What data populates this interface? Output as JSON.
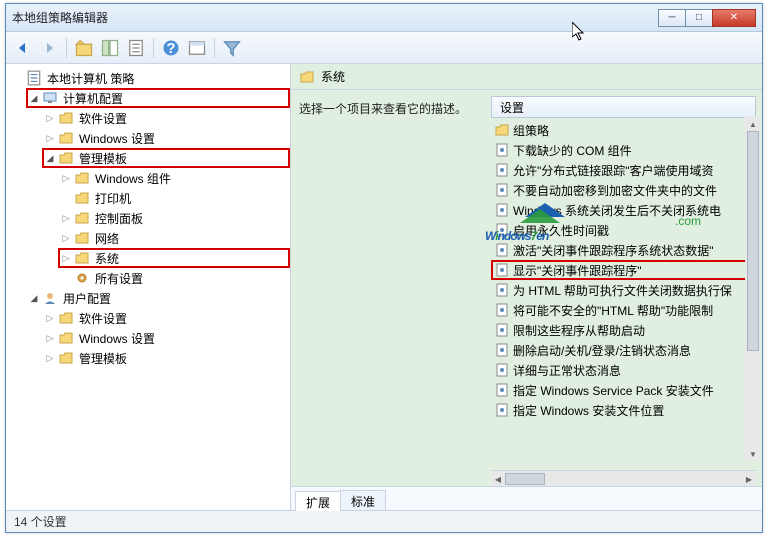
{
  "window": {
    "title": "本地组策略编辑器"
  },
  "tree": {
    "root": "本地计算机 策略",
    "computer": "计算机配置",
    "software": "软件设置",
    "windows": "Windows 设置",
    "admin": "管理模板",
    "win_components": "Windows 组件",
    "printer": "打印机",
    "control_panel": "控制面板",
    "network": "网络",
    "system": "系统",
    "all_settings": "所有设置",
    "user": "用户配置",
    "u_software": "软件设置",
    "u_windows": "Windows 设置",
    "u_admin": "管理模板"
  },
  "right": {
    "header": "系统",
    "desc": "选择一个项目来查看它的描述。",
    "col": "设置",
    "items": [
      "组策略",
      "下载缺少的 COM 组件",
      "允许\"分布式链接跟踪\"客户端使用域资",
      "不要自动加密移到加密文件夹中的文件",
      "Windows 系统关闭发生后不关闭系统电",
      "启用永久性时间戳",
      "激活\"关闭事件跟踪程序系统状态数据\"",
      "显示\"关闭事件跟踪程序\"",
      "为 HTML 帮助可执行文件关闭数据执行保",
      "将可能不安全的\"HTML 帮助\"功能限制",
      "限制这些程序从帮助启动",
      "删除启动/关机/登录/注销状态消息",
      "详细与正常状态消息",
      "指定 Windows Service Pack 安装文件",
      "指定 Windows 安装文件位置"
    ],
    "highlight_index": 7
  },
  "tabs": {
    "extended": "扩展",
    "standard": "标准"
  },
  "status": "14 个设置"
}
